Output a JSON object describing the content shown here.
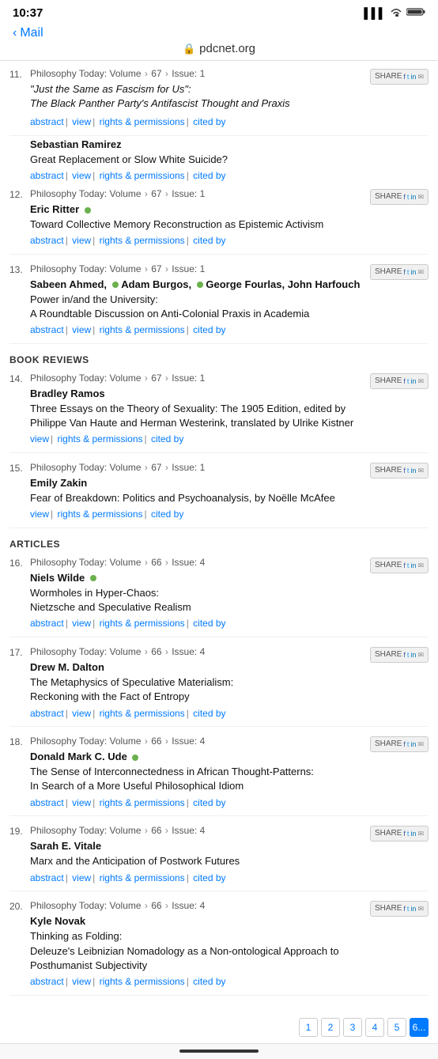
{
  "statusBar": {
    "time": "10:37",
    "signal": "●●●",
    "wifi": "wifi",
    "battery": "battery"
  },
  "nav": {
    "back": "Mail",
    "title": "pdcnet.org"
  },
  "articles": [
    {
      "number": "11.",
      "meta": "Philosophy Today: Volume > 67 > Issue: 1",
      "author": "Sebastian Ramirez",
      "authorDot": false,
      "titleLines": [
        "Great Replacement or Slow White Suicide?"
      ],
      "links": [
        "abstract",
        "view",
        "rights & permissions",
        "cited by"
      ],
      "hasIntro": true,
      "introLines": [
        "“Just the Same as Fascism for Us”:",
        "The Black Panther Party’s Antifascist Thought and Praxis"
      ]
    },
    {
      "number": "12.",
      "meta": "Philosophy Today: Volume > 67 > Issue: 1",
      "author": "Eric Ritter",
      "authorDot": true,
      "titleLines": [
        "Toward Collective Memory Reconstruction as Epistemic",
        "Activism"
      ],
      "links": [
        "abstract",
        "view",
        "rights & permissions",
        "cited by"
      ],
      "hasIntro": false
    },
    {
      "number": "13.",
      "meta": "Philosophy Today: Volume > 67 > Issue: 1",
      "author": "Sabeen Ahmed, ● Adam Burgos, ● George Fourlas, John Harfouch",
      "authorDot": false,
      "multiAuthor": true,
      "titleLines": [
        "Power in/and the University:",
        "A Roundtable Discussion on Anti-Colonial Praxis in",
        "Academia"
      ],
      "links": [
        "abstract",
        "view",
        "rights & permissions",
        "cited by"
      ],
      "hasIntro": false
    }
  ],
  "sectionBookReviews": "Book Reviews",
  "bookReviews": [
    {
      "number": "14.",
      "meta": "Philosophy Today: Volume > 67 > Issue: 1",
      "author": "Bradley Ramos",
      "authorDot": false,
      "titleLines": [
        "Three Essays on the Theory of Sexuality: The 1905",
        "Edition, edited by Philippe Van Haute and Herman",
        "Westerink, translated by Ulrike Kistner"
      ],
      "links": [
        "view",
        "rights & permissions",
        "cited by"
      ],
      "hasIntro": false
    },
    {
      "number": "15.",
      "meta": "Philosophy Today: Volume > 67 > Issue: 1",
      "author": "Emily Zakin",
      "authorDot": false,
      "titleLines": [
        "Fear of Breakdown: Politics and Psychoanalysis, by",
        "Noëlle McAfee"
      ],
      "links": [
        "view",
        "rights & permissions",
        "cited by"
      ],
      "hasIntro": false
    }
  ],
  "sectionArticles": "Articles",
  "mainArticles": [
    {
      "number": "16.",
      "meta": "Philosophy Today: Volume > 66 > Issue: 4",
      "author": "Niels Wilde",
      "authorDot": true,
      "titleLines": [
        "Wormholes in Hyper-Chaos:",
        "Nietzsche and Speculative Realism"
      ],
      "links": [
        "abstract",
        "view",
        "rights & permissions",
        "cited by"
      ]
    },
    {
      "number": "17.",
      "meta": "Philosophy Today: Volume > 66 > Issue: 4",
      "author": "Drew M. Dalton",
      "authorDot": false,
      "titleLines": [
        "The Metaphysics of Speculative Materialism:",
        "Reckoning with the Fact of Entropy"
      ],
      "links": [
        "abstract",
        "view",
        "rights & permissions",
        "cited by"
      ]
    },
    {
      "number": "18.",
      "meta": "Philosophy Today: Volume > 66 > Issue: 4",
      "author": "Donald Mark C. Ude",
      "authorDot": true,
      "titleLines": [
        "The Sense of Interconnectedness in African Thought-",
        "Patterns:",
        "In Search of a More Useful Philosophical Idiom"
      ],
      "links": [
        "abstract",
        "view",
        "rights & permissions",
        "cited by"
      ]
    },
    {
      "number": "19.",
      "meta": "Philosophy Today: Volume > 66 > Issue: 4",
      "author": "Sarah E. Vitale",
      "authorDot": false,
      "titleLines": [
        "Marx and the Anticipation of Postwork Futures"
      ],
      "links": [
        "abstract",
        "view",
        "rights & permissions",
        "cited by"
      ]
    },
    {
      "number": "20.",
      "meta": "Philosophy Today: Volume > 66 > Issue: 4",
      "author": "Kyle Novak",
      "authorDot": false,
      "titleLines": [
        "Thinking as Folding:",
        "Deleuze’s Leibnizian Nomadology as a Non-ontological",
        "Approach to Posthumanist Subjectivity"
      ],
      "links": [
        "abstract",
        "view",
        "rights & permissions",
        "cited by"
      ]
    }
  ],
  "pagination": {
    "pages": [
      "1",
      "2",
      "3",
      "4",
      "5",
      "6..."
    ],
    "currentPage": "6"
  },
  "share": {
    "label": "SHARE"
  }
}
